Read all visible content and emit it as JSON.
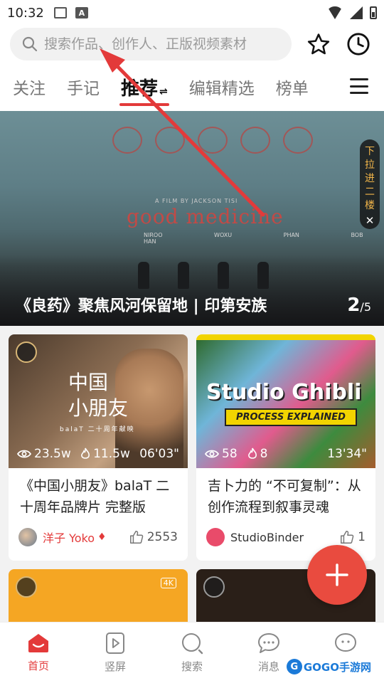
{
  "status_bar": {
    "time": "10:32",
    "notification_letter": "A"
  },
  "search": {
    "placeholder": "搜索作品、创作人、正版视频素材"
  },
  "tabs": [
    {
      "label": "关注"
    },
    {
      "label": "手记"
    },
    {
      "label": "推荐",
      "swap_glyph": "⇌",
      "active": true
    },
    {
      "label": "编辑精选"
    },
    {
      "label": "榜单"
    }
  ],
  "banner": {
    "film_credit": "A FILM BY JACKSON TISI",
    "film_title": "good medicine",
    "film_names": "NIROO WOXU PHAN BOB HAN",
    "caption": "《良药》聚焦风河保留地 | 印第安族",
    "index_current": "2",
    "index_total": "/5",
    "pull_tab_chars": [
      "下",
      "拉",
      "进",
      "二",
      "楼"
    ],
    "pull_tab_close": "✕"
  },
  "cards": [
    {
      "overlay_title": "中国\n小朋友",
      "overlay_sub": "balaT 二十周年献映",
      "views": "23.5w",
      "likes_in_thumb": "11.5w",
      "duration": "06'03\"",
      "title": "《中国小朋友》balaT 二十周年品牌片 完整版",
      "author": "洋子 Yoko",
      "author_color": "#e33a3a",
      "like_count": "2553"
    },
    {
      "overlay_title": "Studio Ghibli",
      "overlay_sub": "PROCESS EXPLAINED",
      "views": "58",
      "likes_in_thumb": "8",
      "duration": "13'34\"",
      "title": "吉卜力的 “不可复制”：从创作流程到叙事灵魂",
      "author": "StudioBinder",
      "author_color": "#333333",
      "like_count": "1"
    }
  ],
  "bottom_cards": [
    {
      "badge": "4K"
    },
    {
      "badge": ""
    }
  ],
  "bottom_nav": [
    {
      "label": "首页",
      "icon": "home-icon",
      "active": true
    },
    {
      "label": "竖屏",
      "icon": "vertical-video-icon"
    },
    {
      "label": "搜索",
      "icon": "discover-icon"
    },
    {
      "label": "消息",
      "icon": "message-icon"
    },
    {
      "label": "我的",
      "icon": "profile-icon"
    }
  ],
  "watermark": {
    "text": "GOGO手游网",
    "symbol": "G"
  },
  "colors": {
    "accent": "#e33a3a",
    "fab": "#e94b3f",
    "arrow": "#e33a3a"
  }
}
